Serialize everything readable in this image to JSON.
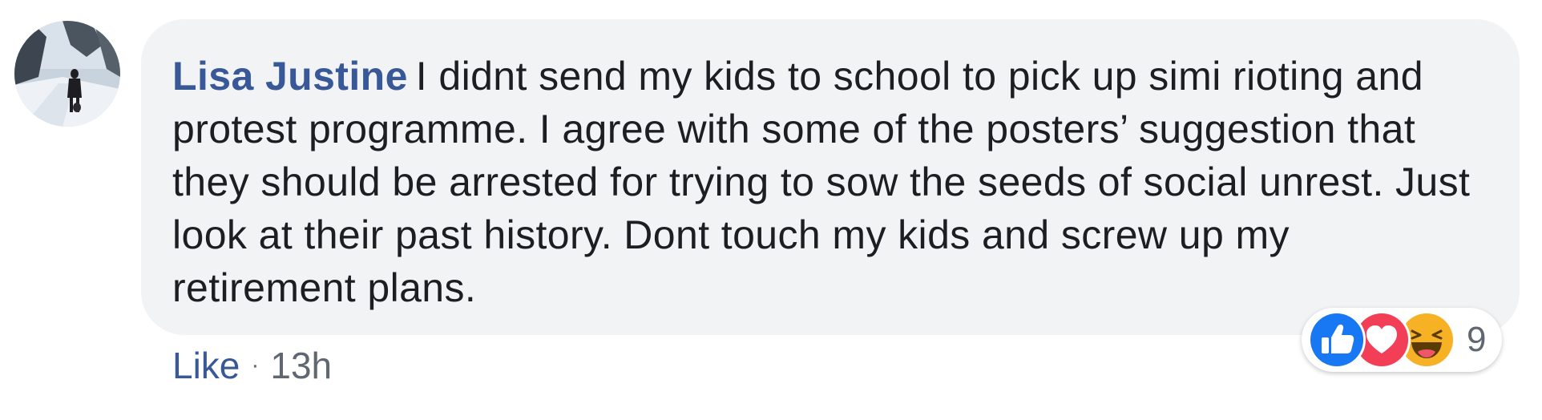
{
  "comment": {
    "author": "Lisa Justine",
    "text": "I didnt send my kids to school to pick up simi rioting and protest programme. I agree with some of the posters’ suggestion that they should be arrested for trying to sow the seeds of social unrest. Just look at their past history. Dont touch my kids and screw up my retirement plans.",
    "avatar_icon": "profile-photo-snowy-street"
  },
  "actions": {
    "like_label": "Like",
    "separator": "·",
    "timestamp": "13h"
  },
  "reactions": {
    "types": [
      "like-reaction-icon",
      "love-reaction-icon",
      "haha-reaction-icon"
    ],
    "count": "9",
    "colors": {
      "like": "#1877f2",
      "love": "#f33e58",
      "haha": "#f7b125"
    }
  },
  "colors": {
    "author": "#385898",
    "bubble_bg": "#f2f3f5",
    "meta_text": "#606770",
    "body_text": "#1c1e21"
  }
}
